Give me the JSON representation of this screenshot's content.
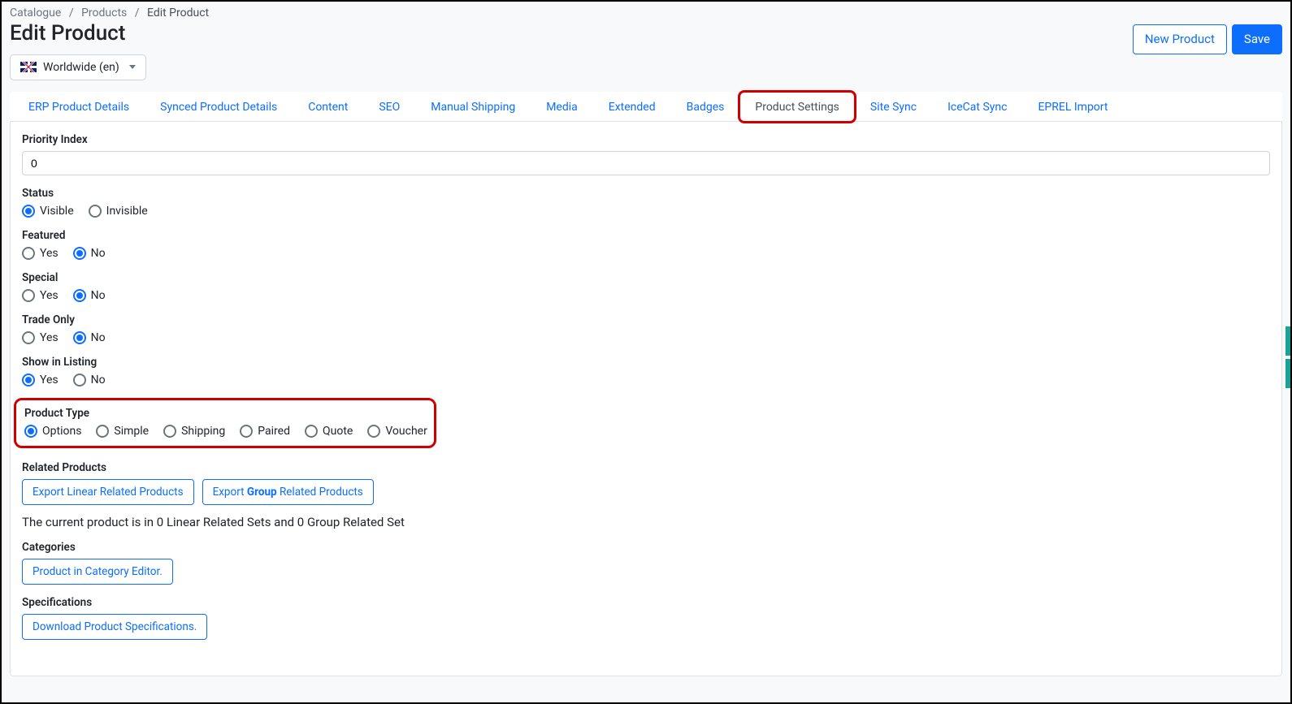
{
  "breadcrumb": {
    "root": "Catalogue",
    "parent": "Products",
    "current": "Edit Product"
  },
  "page": {
    "title": "Edit Product"
  },
  "actions": {
    "new_product": "New Product",
    "save": "Save"
  },
  "locale": {
    "label": "Worldwide (en)"
  },
  "tabs": {
    "erp": "ERP Product Details",
    "synced": "Synced Product Details",
    "content": "Content",
    "seo": "SEO",
    "manual_shipping": "Manual Shipping",
    "media": "Media",
    "extended": "Extended",
    "badges": "Badges",
    "product_settings": "Product Settings",
    "site_sync": "Site Sync",
    "icecat": "IceCat Sync",
    "eprel": "EPREL Import"
  },
  "form": {
    "priority_index": {
      "label": "Priority Index",
      "value": "0"
    },
    "status": {
      "label": "Status",
      "visible": "Visible",
      "invisible": "Invisible",
      "selected": "visible"
    },
    "featured": {
      "label": "Featured",
      "yes": "Yes",
      "no": "No",
      "selected": "no"
    },
    "special": {
      "label": "Special",
      "yes": "Yes",
      "no": "No",
      "selected": "no"
    },
    "trade_only": {
      "label": "Trade Only",
      "yes": "Yes",
      "no": "No",
      "selected": "no"
    },
    "show_listing": {
      "label": "Show in Listing",
      "yes": "Yes",
      "no": "No",
      "selected": "yes"
    },
    "product_type": {
      "label": "Product Type",
      "options": "Options",
      "simple": "Simple",
      "shipping": "Shipping",
      "paired": "Paired",
      "quote": "Quote",
      "voucher": "Voucher",
      "selected": "options"
    },
    "related": {
      "label": "Related Products",
      "export_linear": "Export Linear Related Products",
      "export_group": "Export Group Related Products",
      "info_prefix": "The current product is in ",
      "linear_count": "0",
      "info_mid": " Linear Related Sets and ",
      "group_count": "0",
      "info_suffix": " Group Related Set"
    },
    "categories": {
      "label": "Categories",
      "button": "Product in Category Editor."
    },
    "specifications": {
      "label": "Specifications",
      "button": "Download Product Specifications."
    }
  }
}
